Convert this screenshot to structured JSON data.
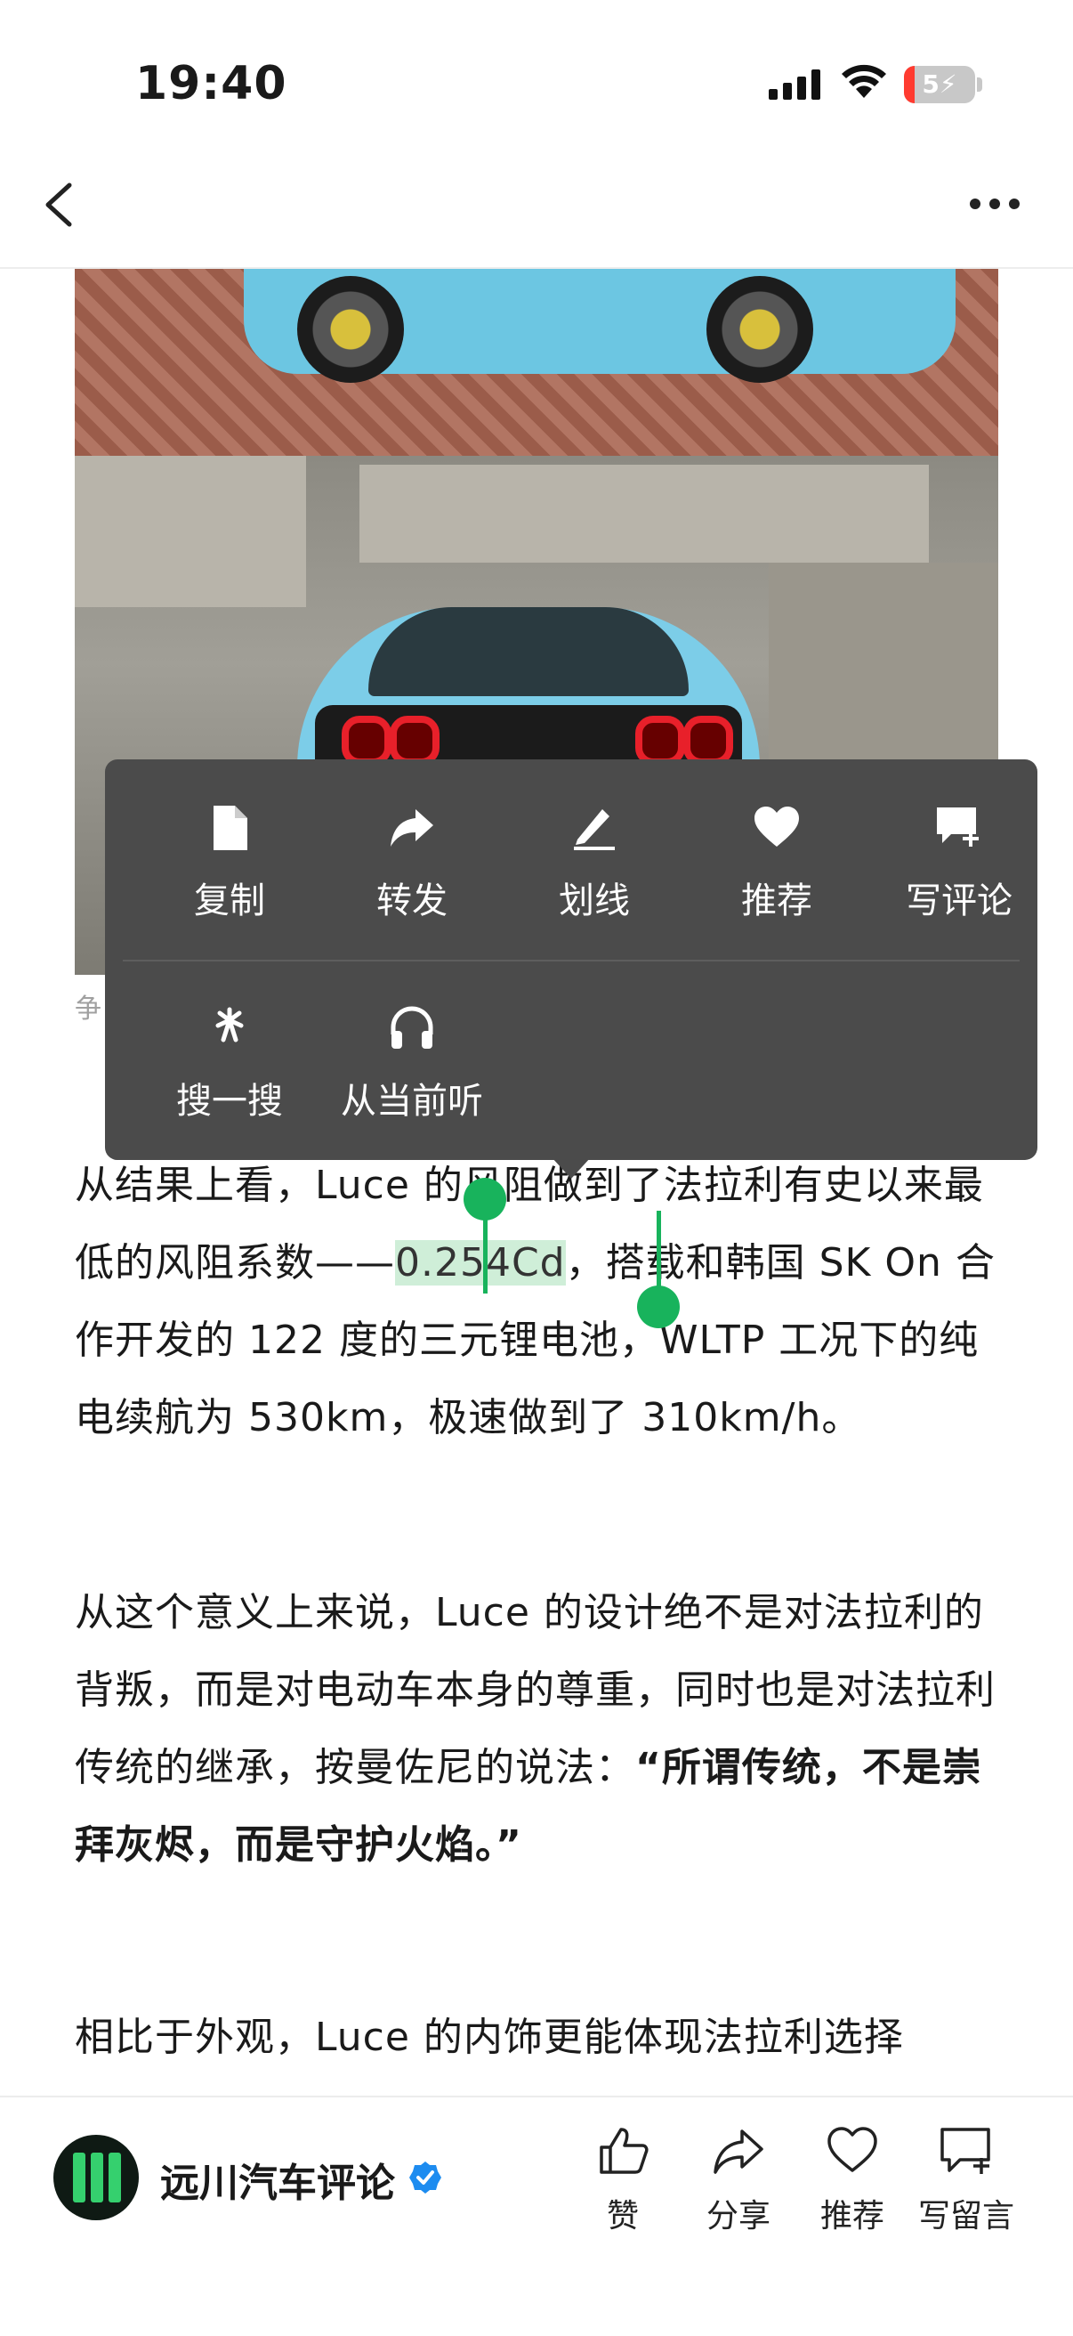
{
  "status_bar": {
    "time": "19:40",
    "battery_level": "5",
    "icons": [
      "signal-icon",
      "wifi-icon",
      "battery-charging-icon"
    ]
  },
  "nav": {
    "back_icon": "chevron-left-icon",
    "more_icon": "more-dots-icon"
  },
  "article": {
    "image_caption_fragment": "争",
    "paragraphs": [
      {
        "before": "从结果上看，Luce 的风阻做到了法拉利有史以来最低的风阻系数——",
        "selected": "0.254Cd",
        "after": "，搭载和韩国 SK On 合作开发的 122 度的三元锂电池，WLTP 工况下的纯电续航为 530km，极速做到了 310km/h。"
      },
      {
        "plain": "从这个意义上来说，Luce 的设计绝不是对法拉利的背叛，而是对电动车本身的尊重，同时也是对法拉利传统的继承，按曼佐尼的说法：",
        "bold": "“所谓传统，不是崇拜灰烬，而是守护火焰。”"
      },
      {
        "plain": "相比于外观，Luce 的内饰更能体现法拉利选择"
      }
    ]
  },
  "context_menu": {
    "row1": [
      {
        "label": "复制",
        "icon": "document-icon"
      },
      {
        "label": "转发",
        "icon": "forward-arrow-icon"
      },
      {
        "label": "划线",
        "icon": "pen-underline-icon"
      },
      {
        "label": "推荐",
        "icon": "heart-icon"
      },
      {
        "label": "写评论",
        "icon": "comment-add-icon"
      }
    ],
    "row2": [
      {
        "label": "搜一搜",
        "icon": "search-sparkle-icon"
      },
      {
        "label": "从当前听",
        "icon": "headphones-icon"
      }
    ]
  },
  "bottom_bar": {
    "author_name": "远川汽车评论",
    "verified_icon": "verified-badge-icon",
    "actions": [
      {
        "label": "赞",
        "icon": "thumbs-up-icon"
      },
      {
        "label": "分享",
        "icon": "share-icon"
      },
      {
        "label": "推荐",
        "icon": "heart-outline-icon"
      },
      {
        "label": "写留言",
        "icon": "comment-add-outline-icon"
      }
    ]
  },
  "colors": {
    "selection_handle": "#18b35c",
    "selection_fill": "#cfeed8",
    "menu_background": "#4b4b4b",
    "verified_badge": "#1d8cf0"
  }
}
